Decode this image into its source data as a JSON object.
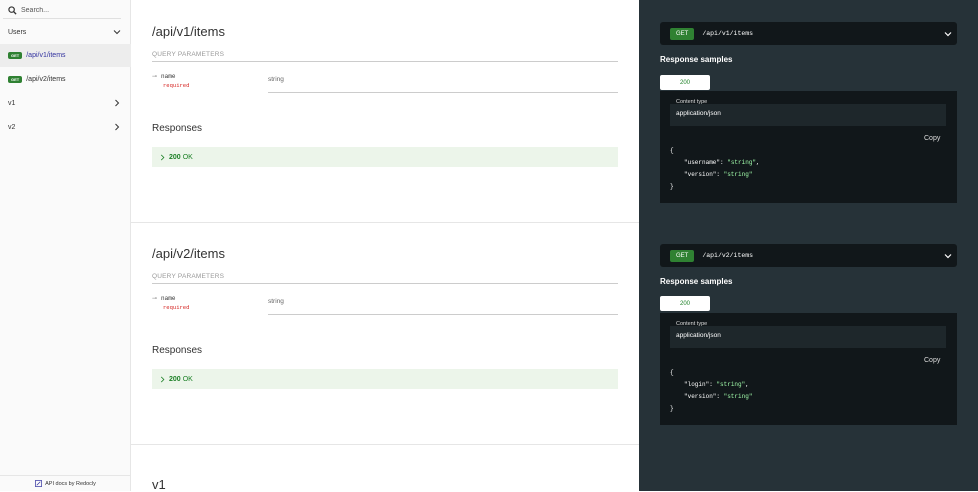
{
  "sidebar": {
    "search_placeholder": "Search...",
    "items": [
      {
        "label": "Users",
        "expanded": true
      },
      {
        "badge": "GET",
        "label": "/api/v1/items",
        "active": true
      },
      {
        "badge": "GET",
        "label": "/api/v2/items",
        "active": false
      },
      {
        "label": "v1",
        "expanded": false
      },
      {
        "label": "v2",
        "expanded": false
      }
    ],
    "footer": "API docs by Redocly"
  },
  "operations": [
    {
      "title": "/api/v1/items",
      "query_params_label": "QUERY PARAMETERS",
      "param": {
        "name": "name",
        "required": "required",
        "type": "string"
      },
      "responses_title": "Responses",
      "response": {
        "code": "200",
        "text": "OK"
      },
      "method": "GET",
      "path": "/api/v1/items",
      "samples_title": "Response samples",
      "tab": "200",
      "content_type_label": "Content type",
      "content_type": "application/json",
      "copy": "Copy",
      "json": {
        "open": "{",
        "close": "}",
        "k1": "\"username\"",
        "v1": "\"string\"",
        "k2": "\"version\"",
        "v2": "\"string\""
      }
    },
    {
      "title": "/api/v2/items",
      "query_params_label": "QUERY PARAMETERS",
      "param": {
        "name": "name",
        "required": "required",
        "type": "string"
      },
      "responses_title": "Responses",
      "response": {
        "code": "200",
        "text": "OK"
      },
      "method": "GET",
      "path": "/api/v2/items",
      "samples_title": "Response samples",
      "tab": "200",
      "content_type_label": "Content type",
      "content_type": "application/json",
      "copy": "Copy",
      "json": {
        "open": "{",
        "close": "}",
        "k1": "\"login\"",
        "v1": "\"string\"",
        "k2": "\"version\"",
        "v2": "\"string\""
      }
    }
  ],
  "section_title": "v1",
  "colors": {
    "get": "#2f8132",
    "dark_panel": "#263238",
    "response_ok": "#1d8127",
    "required": "#d41f1c"
  }
}
